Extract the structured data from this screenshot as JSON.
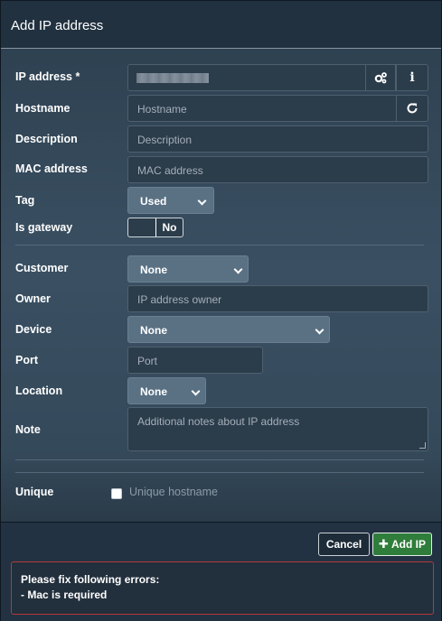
{
  "dialog": {
    "title": "Add IP address"
  },
  "form": {
    "ip_address": {
      "label": "IP address *",
      "value": ""
    },
    "hostname": {
      "label": "Hostname",
      "placeholder": "Hostname"
    },
    "description": {
      "label": "Description",
      "placeholder": "Description"
    },
    "mac": {
      "label": "MAC address",
      "placeholder": "MAC address"
    },
    "tag": {
      "label": "Tag",
      "value": "Used"
    },
    "is_gateway": {
      "label": "Is gateway",
      "value": "No"
    },
    "customer": {
      "label": "Customer",
      "value": "None"
    },
    "owner": {
      "label": "Owner",
      "placeholder": "IP address owner"
    },
    "device": {
      "label": "Device",
      "value": "None"
    },
    "port": {
      "label": "Port",
      "placeholder": "Port"
    },
    "location": {
      "label": "Location",
      "value": "None"
    },
    "note": {
      "label": "Note",
      "placeholder": "Additional notes about IP address"
    },
    "unique": {
      "label": "Unique",
      "checkbox_label": "Unique hostname",
      "checked": false
    }
  },
  "icons": {
    "ip_settings": "gears-icon",
    "ip_info": "info-icon",
    "hostname_refresh": "refresh-icon",
    "add": "plus-icon"
  },
  "buttons": {
    "cancel": "Cancel",
    "add": "Add IP"
  },
  "errors": {
    "title": "Please fix following errors:",
    "items": [
      "- Mac is required"
    ]
  },
  "colors": {
    "accent_green": "#2f7d3a",
    "error_border": "#b43a3a"
  }
}
